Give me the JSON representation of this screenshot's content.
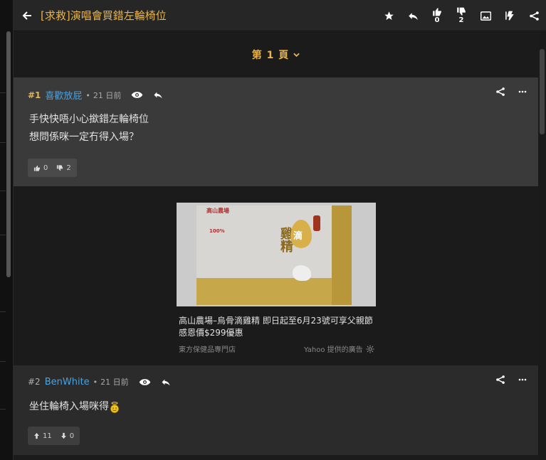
{
  "header": {
    "title": "[求救]演唱會買錯左輪椅位",
    "like_count": "0",
    "dislike_count": "2",
    "icons": [
      "back-arrow-icon",
      "star-icon",
      "reply-icon",
      "thumbs-up-icon",
      "thumbs-down-icon",
      "image-icon",
      "flash-icon",
      "share-icon"
    ]
  },
  "page": {
    "label": "第 1 頁"
  },
  "comments": [
    {
      "number": "#1",
      "user": "喜歡放屁",
      "time": "21 日前",
      "lines": [
        "手快快唔小心撳錯左輪椅位",
        "想問係咪一定冇得入場？"
      ],
      "likes": "0",
      "dislikes": "2"
    },
    {
      "number": "#2",
      "user": "BenWhite",
      "time": "21 日前",
      "lines": [
        "坐住輪椅入場咪得"
      ],
      "likes": "11",
      "dislikes": "0"
    }
  ],
  "ad": {
    "title": "高山農場–烏骨滴雞精 即日起至6月23號可享父親節感恩價$299優惠",
    "source": "東方保健品專門店",
    "provider": "Yahoo 提供的廣告",
    "image_text": {
      "brand": "高山農場",
      "product": "雞精",
      "drop": "滴",
      "percent": "100%"
    }
  },
  "colors": {
    "accent": "#e8b44a",
    "username": "#4aa3df",
    "header_bg": "#262626",
    "comment_bg": "#3a3a3a"
  }
}
